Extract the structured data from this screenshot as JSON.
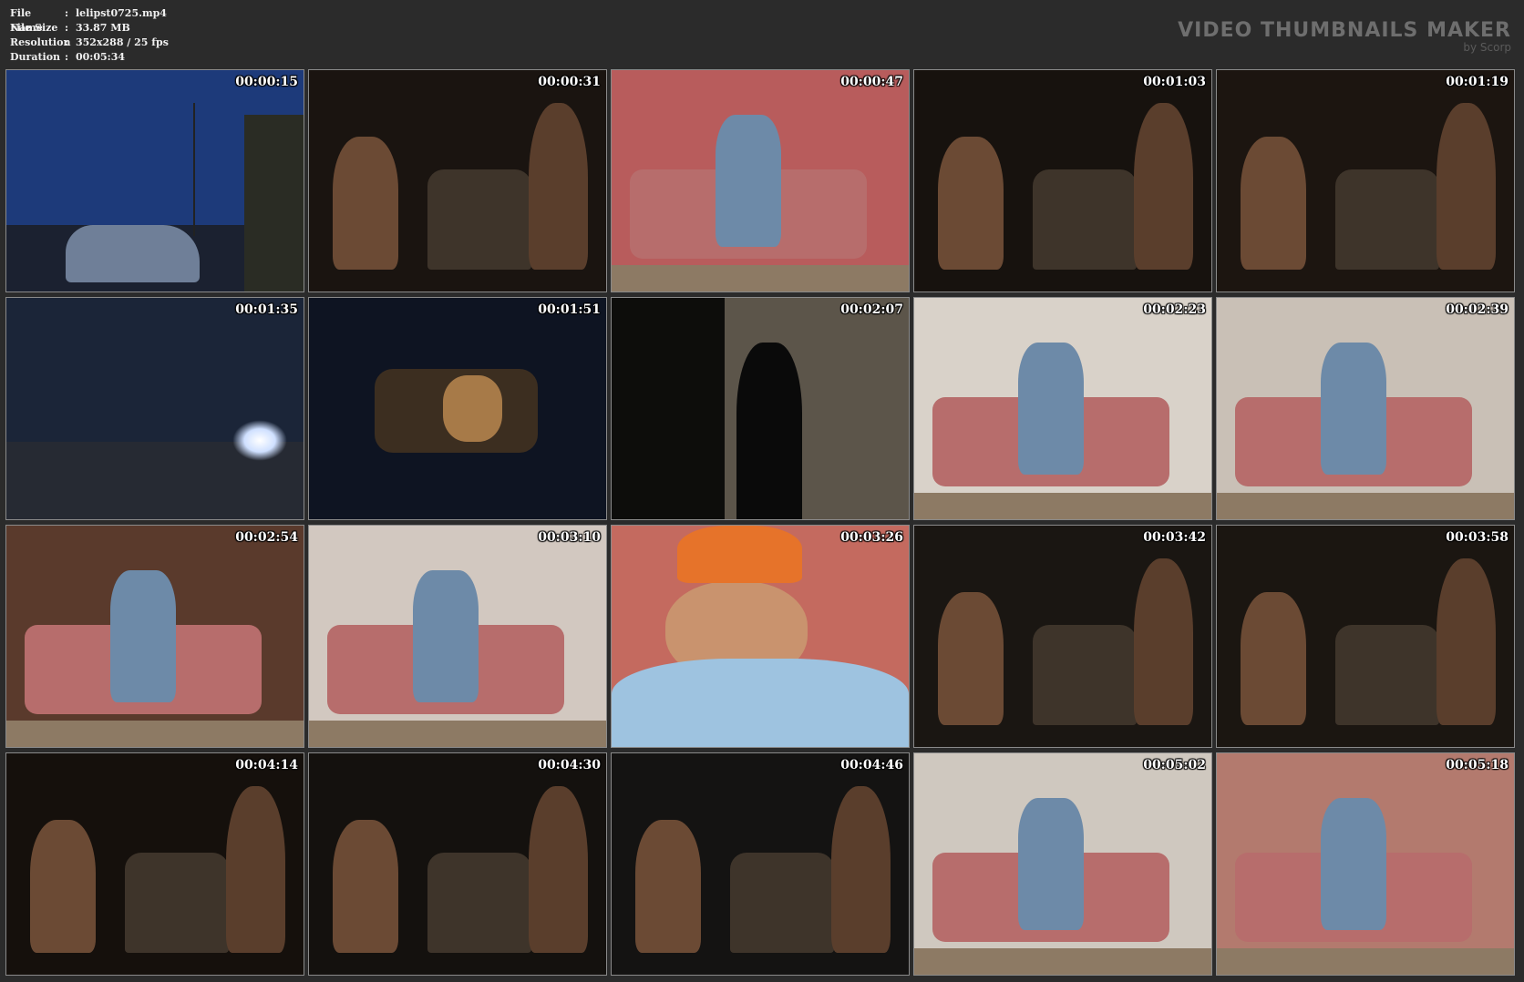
{
  "info": {
    "rows": [
      {
        "key": "File Name",
        "sep": ":",
        "value": "lelipst0725.mp4"
      },
      {
        "key": "File Size",
        "sep": ":",
        "value": "33.87 MB"
      },
      {
        "key": "Resolution",
        "sep": ":",
        "value": "352x288 / 25 fps"
      },
      {
        "key": "Duration",
        "sep": ":",
        "value": "00:05:34"
      }
    ]
  },
  "brand": {
    "title": "VIDEO THUMBNAILS MAKER",
    "subtitle": "by Scorp"
  },
  "thumbnails": [
    {
      "time": "00:00:15",
      "scene": "night-road-car",
      "bg": "#1d3a7a"
    },
    {
      "time": "00:00:31",
      "scene": "car-interior-dark",
      "bg": "#1a1410"
    },
    {
      "time": "00:00:47",
      "scene": "man-floral-sofa-phone",
      "bg": "#b85c5c"
    },
    {
      "time": "00:01:03",
      "scene": "car-interior-dark",
      "bg": "#17120e"
    },
    {
      "time": "00:01:19",
      "scene": "car-interior-dark",
      "bg": "#1c1510"
    },
    {
      "time": "00:01:35",
      "scene": "headlights-night",
      "bg": "#1b2538"
    },
    {
      "time": "00:01:51",
      "scene": "car-window-night",
      "bg": "#0e1422"
    },
    {
      "time": "00:02:07",
      "scene": "woman-doorway",
      "bg": "#0d0d0b"
    },
    {
      "time": "00:02:23",
      "scene": "two-women-room",
      "bg": "#d9d2c9"
    },
    {
      "time": "00:02:39",
      "scene": "man-sofa-women",
      "bg": "#c9c0b6"
    },
    {
      "time": "00:02:54",
      "scene": "women-room",
      "bg": "#5a3a2c"
    },
    {
      "time": "00:03:10",
      "scene": "man-bending-sofa",
      "bg": "#d2c8c0"
    },
    {
      "time": "00:03:26",
      "scene": "man-closeup-phone",
      "bg": "#c46a5f"
    },
    {
      "time": "00:03:42",
      "scene": "car-interior-dark",
      "bg": "#1a1612"
    },
    {
      "time": "00:03:58",
      "scene": "car-interior-dark",
      "bg": "#1b1611"
    },
    {
      "time": "00:04:14",
      "scene": "woman-closeup-dark",
      "bg": "#15100c"
    },
    {
      "time": "00:04:30",
      "scene": "car-interior-dark",
      "bg": "#14110e"
    },
    {
      "time": "00:04:46",
      "scene": "car-interior-dark",
      "bg": "#141312"
    },
    {
      "time": "00:05:02",
      "scene": "man-sofa-wide",
      "bg": "#cfc8bf"
    },
    {
      "time": "00:05:18",
      "scene": "sofa-gun-closeup",
      "bg": "#b37a6e"
    }
  ]
}
